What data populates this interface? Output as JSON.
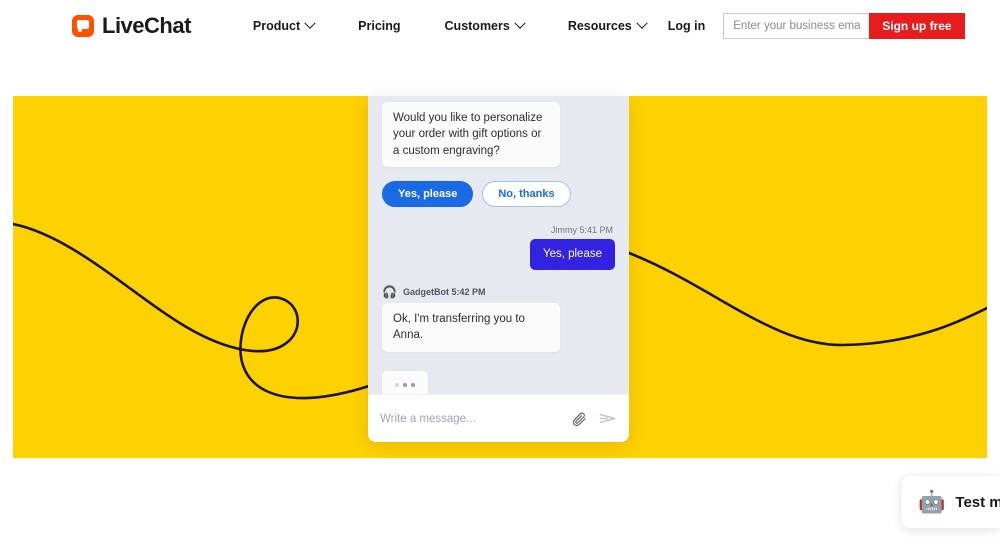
{
  "nav": {
    "brand": "LiveChat",
    "brand_icon": "livechat-logo-icon",
    "links": [
      {
        "label": "Product",
        "has_dropdown": true
      },
      {
        "label": "Pricing",
        "has_dropdown": false
      },
      {
        "label": "Customers",
        "has_dropdown": true
      },
      {
        "label": "Resources",
        "has_dropdown": true
      }
    ],
    "login_label": "Log in",
    "email_placeholder": "Enter your business email",
    "email_value": "",
    "signup_label": "Sign up free",
    "signup_color": "#e81c1c"
  },
  "hero": {
    "background_color": "#fed100"
  },
  "chat": {
    "background_color": "#e7e9f1",
    "bot_message_1": "Would you like to personalize your order with gift options or a custom engraving?",
    "quick_replies": [
      {
        "label": "Yes, please",
        "style": "primary"
      },
      {
        "label": "No, thanks",
        "style": "secondary"
      }
    ],
    "user_meta": "Jimmy 5:41 PM",
    "user_message": "Yes, please",
    "user_bubble_color": "#3322e0",
    "agent_avatar_icon": "headphones-emoji",
    "agent_avatar_glyph": "🎧",
    "agent_meta": "GadgetBot 5:42 PM",
    "agent_message": "Ok, I'm transferring you to Anna.",
    "typing_indicator": "typing-dots",
    "input_placeholder": "Write a message...",
    "input_value": "",
    "attach_icon": "paperclip-icon",
    "send_icon": "send-icon"
  },
  "test_me": {
    "icon": "robot-emoji",
    "icon_glyph": "🤖",
    "label": "Test me"
  }
}
